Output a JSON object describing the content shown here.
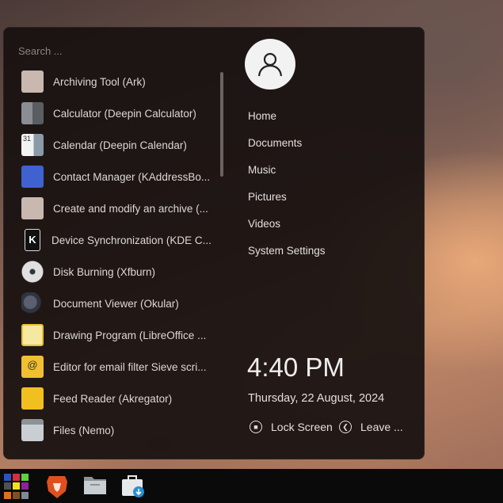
{
  "search": {
    "placeholder": "Search ..."
  },
  "apps": [
    {
      "label": "Archiving Tool (Ark)",
      "icon": "archive-icon"
    },
    {
      "label": "Calculator (Deepin Calculator)",
      "icon": "calculator-icon"
    },
    {
      "label": "Calendar (Deepin Calendar)",
      "icon": "calendar-icon",
      "icon_text": "31"
    },
    {
      "label": "Contact Manager (KAddressBo...",
      "icon": "contact-icon"
    },
    {
      "label": "Create and modify an archive (...",
      "icon": "archive-icon"
    },
    {
      "label": "Device Synchronization (KDE C...",
      "icon": "kdeconnect-icon",
      "icon_text": "K"
    },
    {
      "label": "Disk Burning (Xfburn)",
      "icon": "disc-icon"
    },
    {
      "label": "Document Viewer (Okular)",
      "icon": "okular-icon"
    },
    {
      "label": "Drawing Program (LibreOffice ...",
      "icon": "draw-icon"
    },
    {
      "label": "Editor for email filter Sieve scri...",
      "icon": "email-icon",
      "icon_text": "@"
    },
    {
      "label": "Feed Reader (Akregator)",
      "icon": "rss-icon"
    },
    {
      "label": "Files (Nemo)",
      "icon": "folder-icon"
    }
  ],
  "places": [
    "Home",
    "Documents",
    "Music",
    "Pictures",
    "Videos",
    "System Settings"
  ],
  "clock": {
    "time": "4:40 PM",
    "date": "Thursday, 22 August, 2024"
  },
  "actions": {
    "lock": "Lock Screen",
    "leave": "Leave ..."
  }
}
